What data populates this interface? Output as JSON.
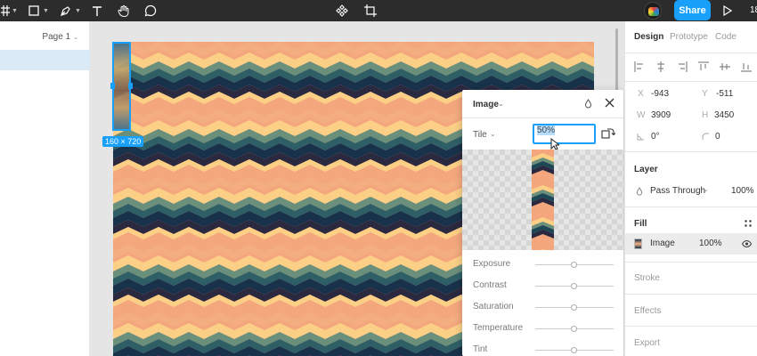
{
  "toolbar": {
    "tools": [
      "frame-icon",
      "shape-icon",
      "pen-icon",
      "text-icon",
      "hand-icon",
      "comment-icon"
    ],
    "center_tools": [
      "component-icon",
      "crop-icon"
    ],
    "share_label": "Share",
    "zoom_partial": "18"
  },
  "left_panel": {
    "page_label": "Page 1"
  },
  "canvas": {
    "selection_size": "160 × 720",
    "pattern_colors": [
      "#f4a77d",
      "#fbcf86",
      "#4b7d6a",
      "#1c4756",
      "#17324a",
      "#2b2940"
    ]
  },
  "image_popover": {
    "title": "Image",
    "mode_label": "Tile",
    "scale_value": "50%",
    "adjustments": [
      {
        "label": "Exposure",
        "value": 0
      },
      {
        "label": "Contrast",
        "value": 0
      },
      {
        "label": "Saturation",
        "value": 0
      },
      {
        "label": "Temperature",
        "value": 0
      },
      {
        "label": "Tint",
        "value": 0
      }
    ]
  },
  "right_panel": {
    "tabs": [
      "Design",
      "Prototype",
      "Code"
    ],
    "x_label": "X",
    "x_value": "-943",
    "y_label": "Y",
    "y_value": "-511",
    "w_label": "W",
    "w_value": "3909",
    "h_label": "H",
    "h_value": "3450",
    "rotation_value": "0°",
    "radius_value": "0",
    "layer_title": "Layer",
    "blend_mode": "Pass Through",
    "layer_opacity": "100%",
    "fill_title": "Fill",
    "fill_type": "Image",
    "fill_opacity": "100%",
    "stroke_title": "Stroke",
    "effects_title": "Effects",
    "export_title": "Export"
  },
  "colors": {
    "accent": "#18a0fb",
    "toolbar_bg": "#2c2c2c"
  }
}
